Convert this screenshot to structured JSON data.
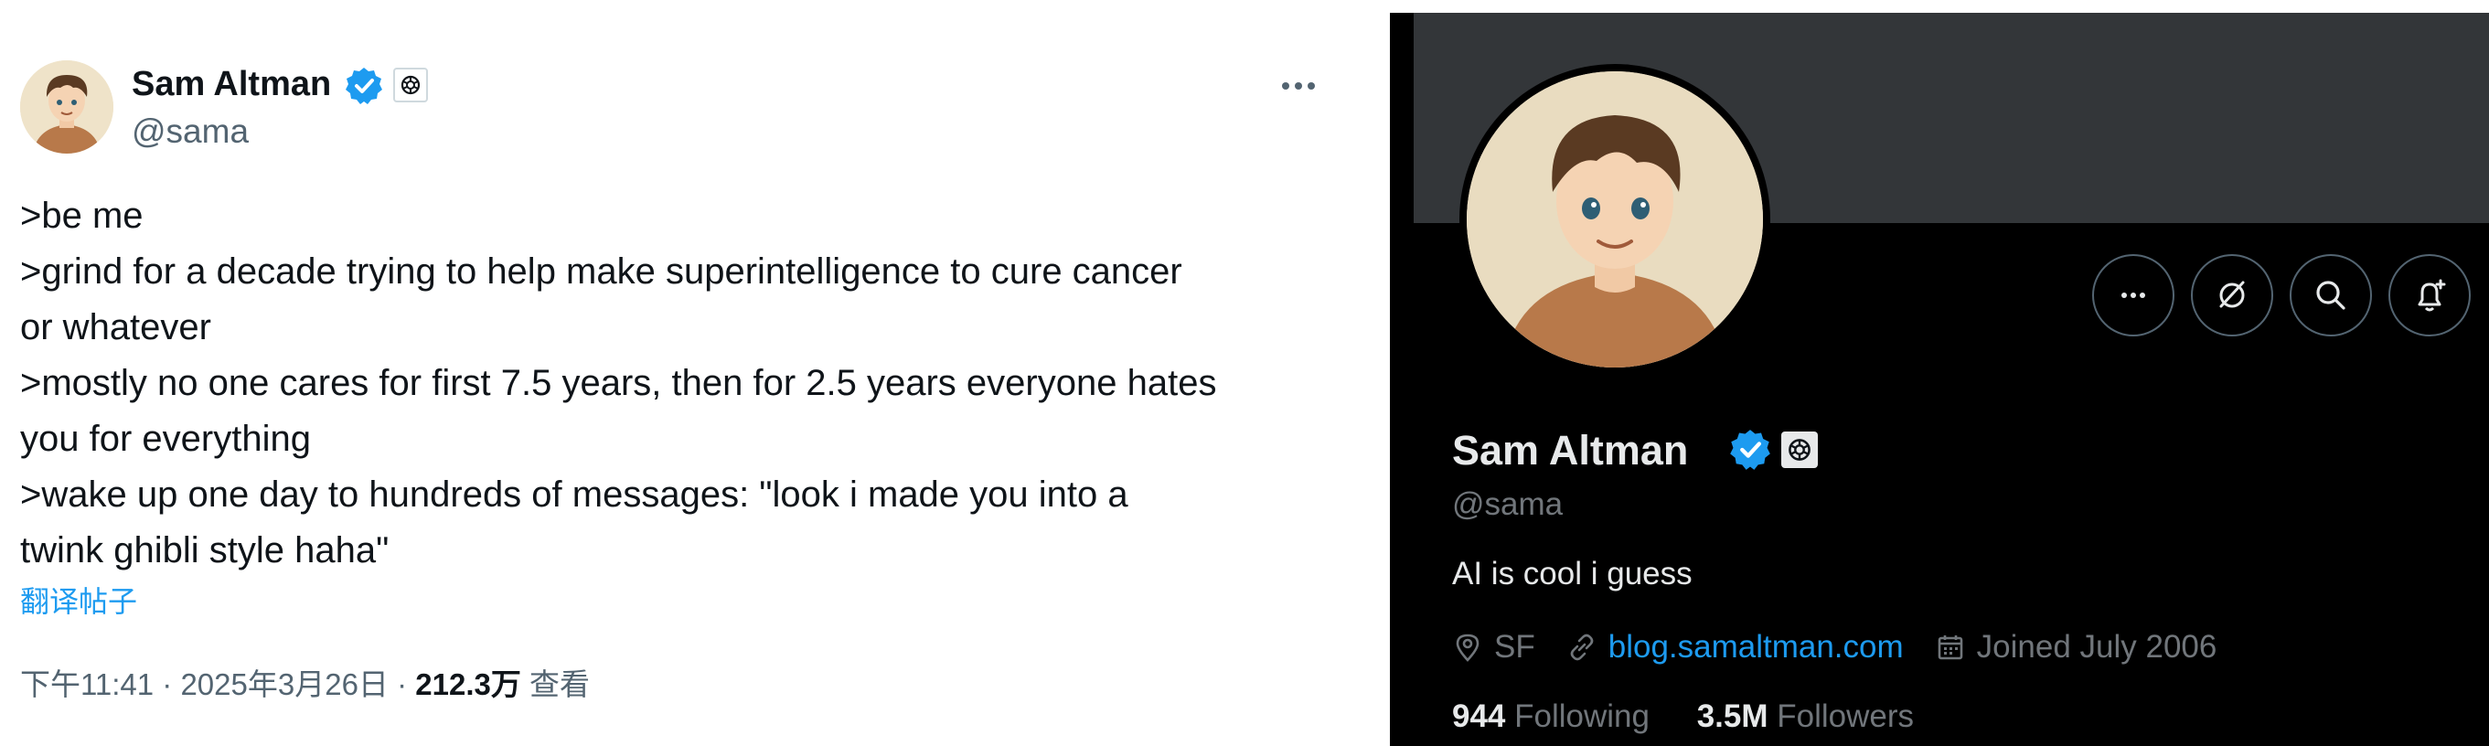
{
  "tweet": {
    "author_name": "Sam Altman",
    "handle": "@sama",
    "lines": [
      ">be me",
      ">grind for a decade trying to help make superintelligence to cure cancer",
      "or whatever",
      ">mostly no one cares for first 7.5 years, then for 2.5 years everyone hates",
      "you for everything",
      ">wake up one day to hundreds of messages: \"look i made you into a",
      "twink ghibli style haha\""
    ],
    "translate_label": "翻译帖子",
    "meta_time": "下午11:41 · 2025年3月26日 · ",
    "meta_views": "212.3万",
    "meta_views_label": " 查看",
    "icons": {
      "verified": "verified-badge-icon",
      "affiliation": "openai-logo-icon",
      "more": "more-dots-icon"
    }
  },
  "profile": {
    "name": "Sam Altman",
    "handle": "@sama",
    "bio": "AI is cool i guess",
    "location": "SF",
    "website": "blog.samaltman.com",
    "joined": "Joined July 2006",
    "following_count": "944",
    "following_label": " Following",
    "followers_count": "3.5M",
    "followers_label": " Followers",
    "action_icons": [
      "more-dots-icon",
      "grok-icon",
      "search-icon",
      "notification-bell-icon"
    ]
  },
  "colors": {
    "accent_blue": "#1d9bf0",
    "text_primary_light": "#0f1419",
    "text_secondary_light": "#536471",
    "profile_background": "#000000",
    "banner_gray": "#333639",
    "text_primary_dark": "#e7e9ea",
    "text_secondary_dark": "#71767b"
  }
}
